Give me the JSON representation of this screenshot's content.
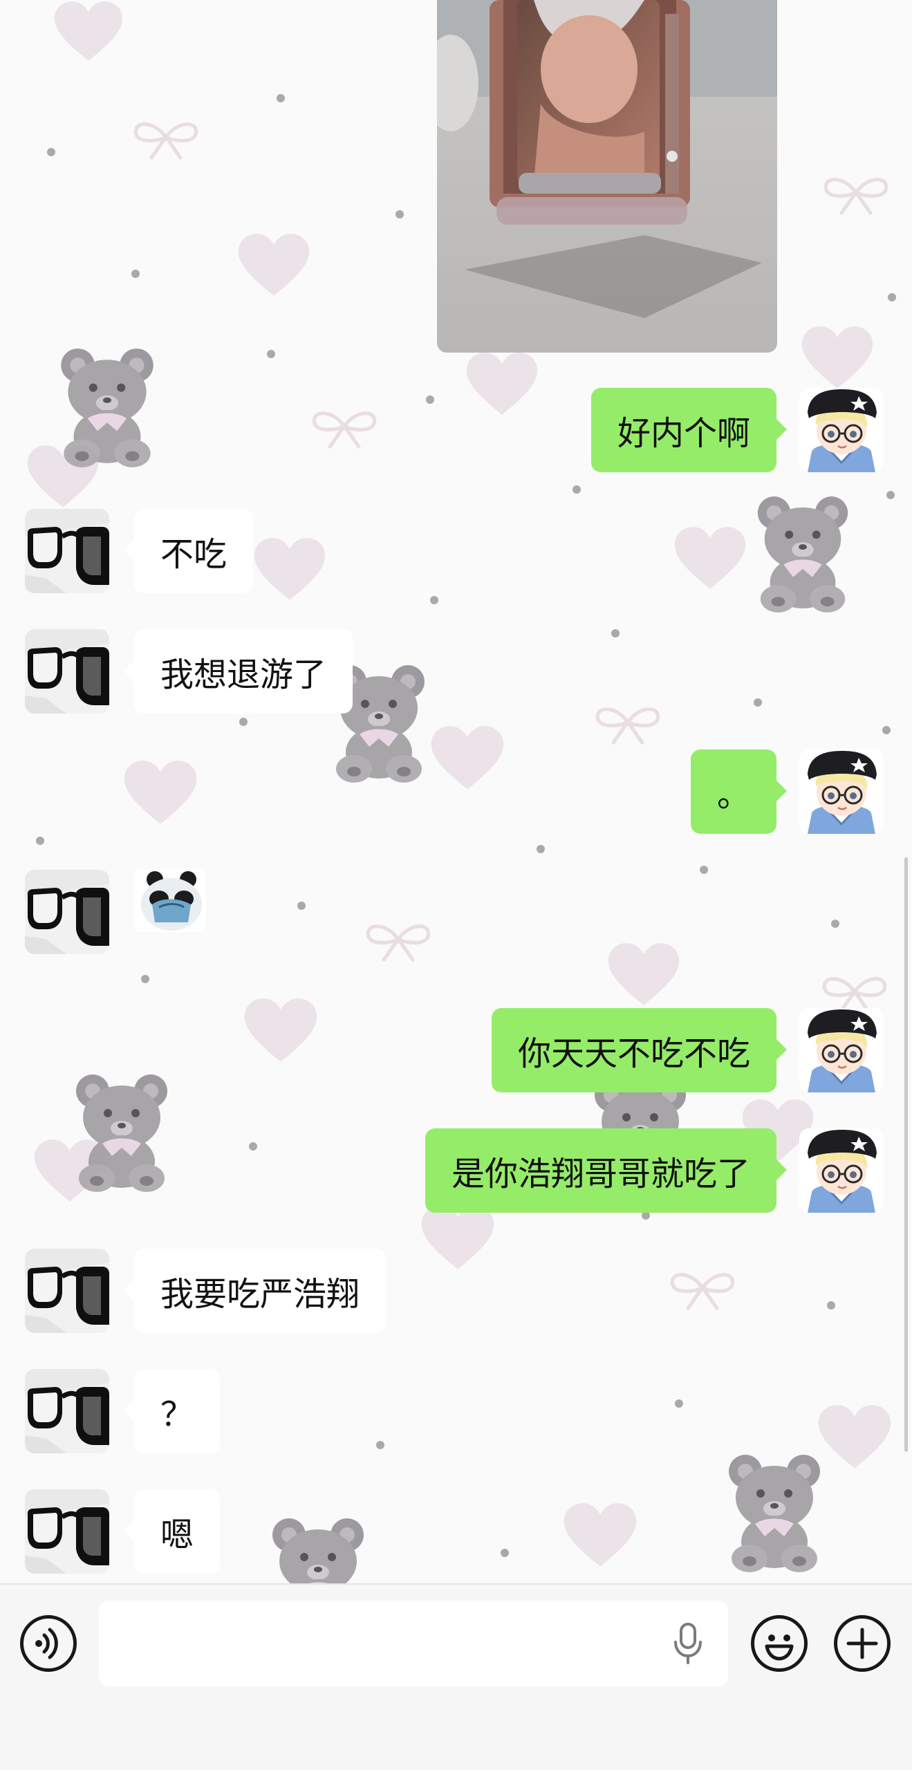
{
  "messages": [
    {
      "side": "me",
      "text": "好内个啊"
    },
    {
      "side": "them",
      "text": "不吃"
    },
    {
      "side": "them",
      "text": "我想退游了"
    },
    {
      "side": "me",
      "text": "。"
    },
    {
      "side": "them",
      "text": "",
      "sticker": "panda-meme-sticker"
    },
    {
      "side": "me",
      "text": "你天天不吃不吃"
    },
    {
      "side": "me",
      "text": "是你浩翔哥哥就吃了"
    },
    {
      "side": "them",
      "text": "我要吃严浩翔"
    },
    {
      "side": "them",
      "text": "？"
    },
    {
      "side": "them",
      "text": "嗯"
    }
  ],
  "photo_message": {
    "side": "me",
    "subject": "acrylic-photo-stand"
  },
  "input_bar": {
    "value": "",
    "icons": {
      "voice_toggle": "voice-mode-icon",
      "mic": "microphone-icon",
      "emoji": "emoji-icon",
      "more": "plus-icon"
    }
  },
  "colors": {
    "my_bubble": "#95ec69",
    "their_bubble": "#ffffff",
    "background": "#fafafa",
    "input_bar": "#f6f6f6"
  }
}
